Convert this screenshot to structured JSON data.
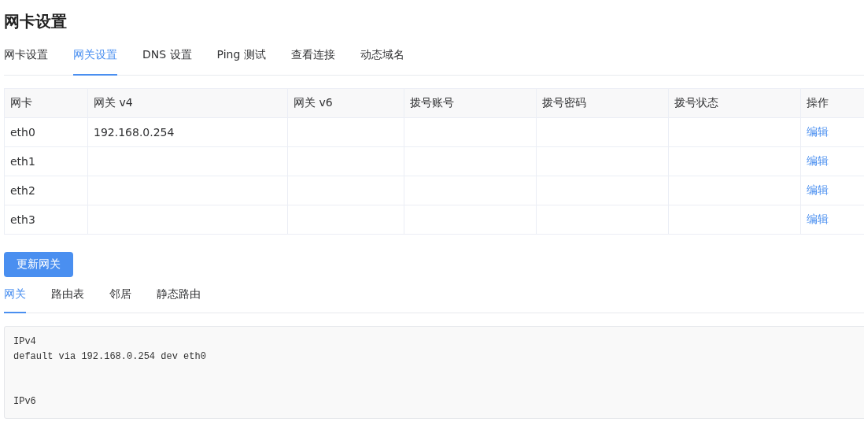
{
  "title": "网卡设置",
  "tabs": [
    {
      "label": "网卡设置",
      "selected": false
    },
    {
      "label": "网关设置",
      "selected": true
    },
    {
      "label": "DNS 设置",
      "selected": false
    },
    {
      "label": "Ping 测试",
      "selected": false
    },
    {
      "label": "查看连接",
      "selected": false
    },
    {
      "label": "动态域名",
      "selected": false
    }
  ],
  "table": {
    "columns": [
      "网卡",
      "网关 v4",
      "网关 v6",
      "拨号账号",
      "拨号密码",
      "拨号状态",
      "操作"
    ],
    "rows": [
      {
        "nic": "eth0",
        "gateway_v4": "192.168.0.254",
        "action": "编辑"
      },
      {
        "nic": "eth1",
        "action": "编辑"
      },
      {
        "nic": "eth2",
        "action": "编辑"
      },
      {
        "nic": "eth3",
        "action": "编辑"
      }
    ]
  },
  "update_button": "更新网关",
  "sub_tabs": [
    {
      "label": "网关",
      "selected": true
    },
    {
      "label": "路由表",
      "selected": false
    },
    {
      "label": "邻居",
      "selected": false
    },
    {
      "label": "静态路由",
      "selected": false
    }
  ],
  "output": "IPv4\ndefault via 192.168.0.254 dev eth0\n\n\nIPv6"
}
